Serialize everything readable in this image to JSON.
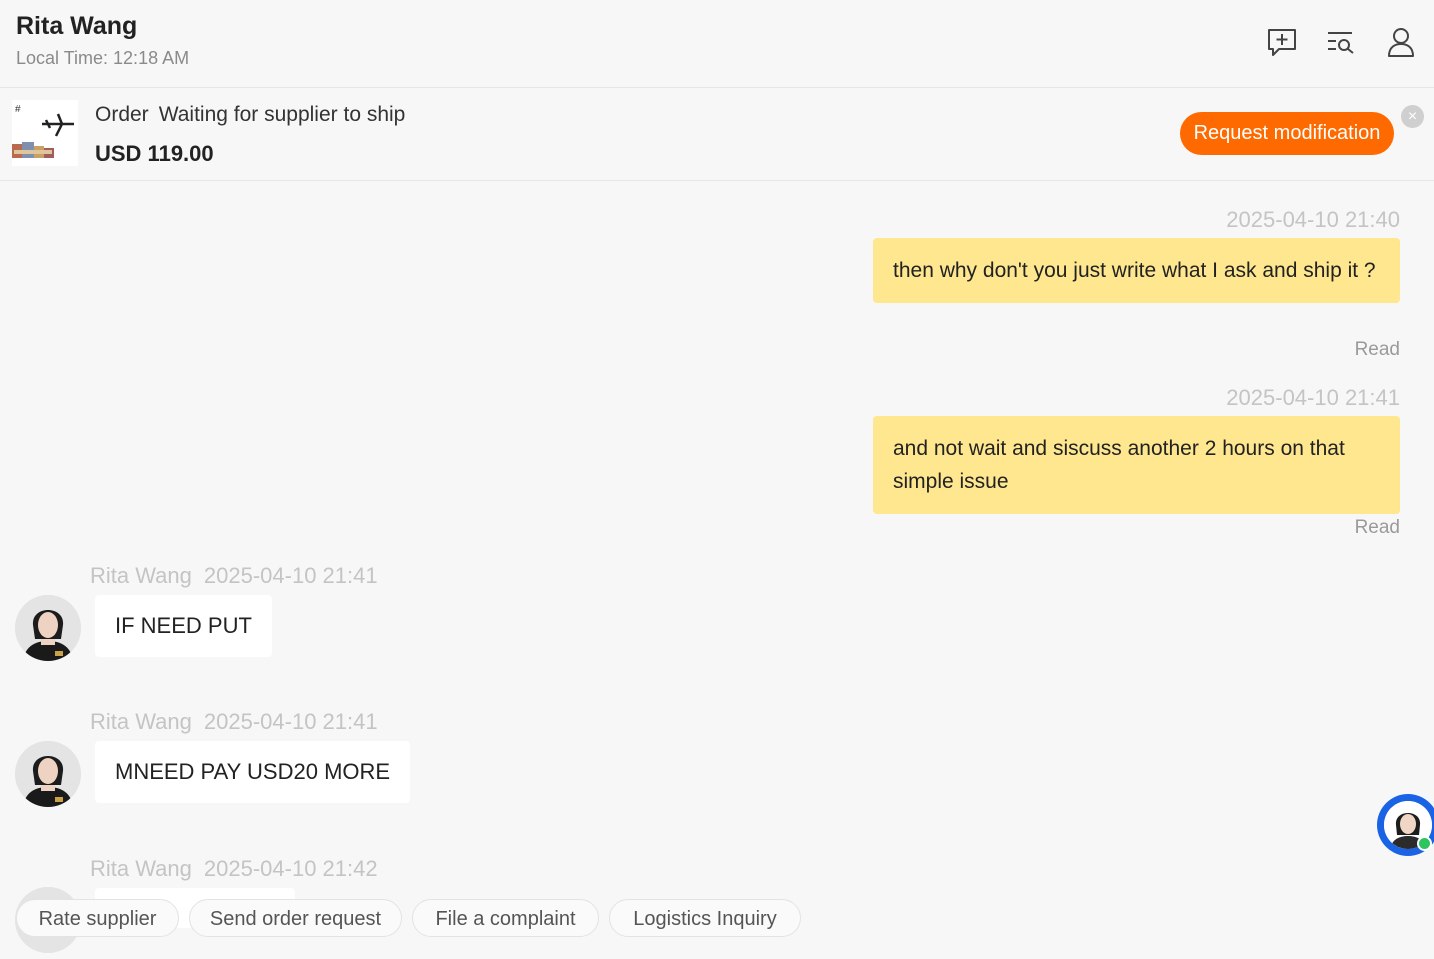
{
  "header": {
    "contact_name": "Rita Wang",
    "local_time": "Local Time: 12:18 AM",
    "icons": [
      "add-message-icon",
      "search-list-icon",
      "profile-icon"
    ]
  },
  "order": {
    "label": "Order",
    "status": "Waiting for supplier to ship",
    "price": "USD 119.00",
    "action_label": "Request modification",
    "close_symbol": "×"
  },
  "messages": [
    {
      "direction": "out",
      "timestamp": "2025-04-10 21:40",
      "text": "then why don't you just write what I ask and ship it ?",
      "status": "Read"
    },
    {
      "direction": "out",
      "timestamp": "2025-04-10 21:41",
      "text": "and not wait and siscuss another 2 hours on that simple issue",
      "status": "Read"
    },
    {
      "direction": "in",
      "sender": "Rita Wang",
      "timestamp": "2025-04-10 21:41",
      "text": "IF NEED PUT"
    },
    {
      "direction": "in",
      "sender": "Rita Wang",
      "timestamp": "2025-04-10 21:41",
      "text": "MNEED PAY USD20 MORE"
    },
    {
      "direction": "in",
      "sender": "Rita Wang",
      "timestamp": "2025-04-10 21:42",
      "text": ""
    }
  ],
  "quick_actions": [
    "Rate supplier",
    "Send order request",
    "File a complaint",
    "Logistics Inquiry"
  ],
  "colors": {
    "accent": "#ff6a00",
    "outgoing_bubble": "#ffe78f",
    "assistant_ring": "#1b63e5",
    "online": "#2ec45e"
  }
}
